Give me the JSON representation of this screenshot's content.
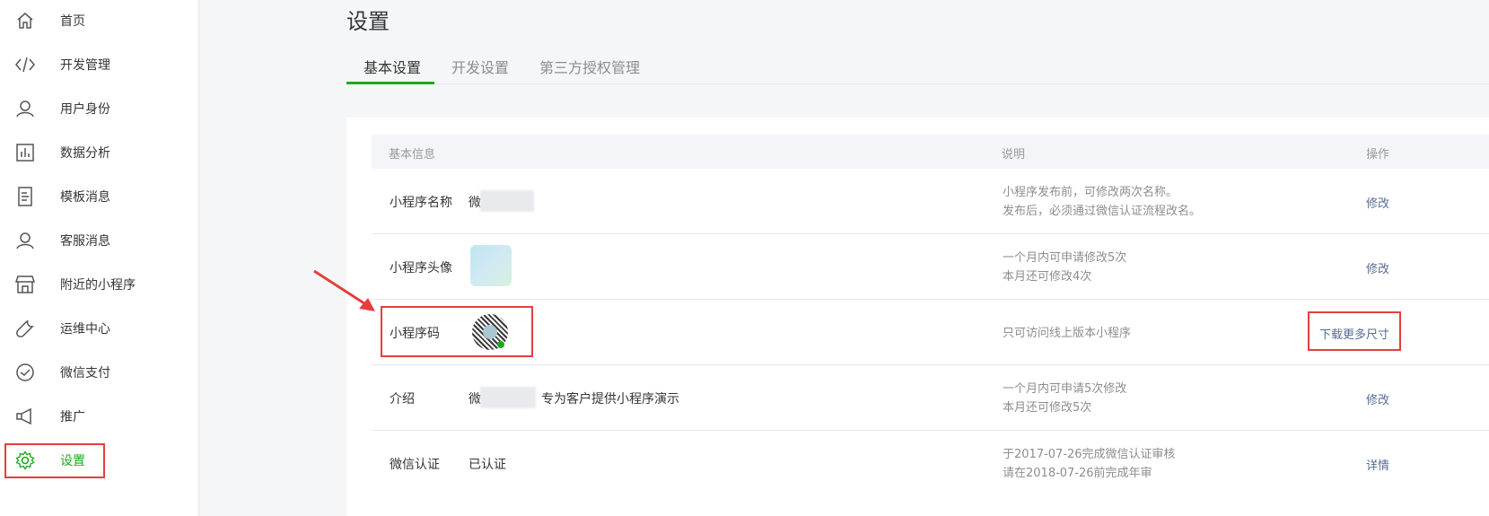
{
  "sidebar": {
    "items": [
      {
        "label": "首页",
        "icon": "home-icon"
      },
      {
        "label": "开发管理",
        "icon": "code-icon"
      },
      {
        "label": "用户身份",
        "icon": "user-icon"
      },
      {
        "label": "数据分析",
        "icon": "chart-icon"
      },
      {
        "label": "模板消息",
        "icon": "document-icon"
      },
      {
        "label": "客服消息",
        "icon": "support-icon"
      },
      {
        "label": "附近的小程序",
        "icon": "store-icon"
      },
      {
        "label": "运维中心",
        "icon": "wrench-icon"
      },
      {
        "label": "微信支付",
        "icon": "payment-icon"
      },
      {
        "label": "推广",
        "icon": "megaphone-icon"
      },
      {
        "label": "设置",
        "icon": "gear-icon",
        "active": true
      }
    ]
  },
  "page": {
    "title": "设置",
    "tabs": [
      "基本设置",
      "开发设置",
      "第三方授权管理"
    ]
  },
  "table": {
    "headers": {
      "info": "基本信息",
      "desc": "说明",
      "op": "操作"
    },
    "rows": [
      {
        "label": "小程序名称",
        "value": "微",
        "desc": [
          "小程序发布前，可修改两次名称。",
          "发布后，必须通过微信认证流程改名。"
        ],
        "action": "修改"
      },
      {
        "label": "小程序头像",
        "value": "",
        "desc": [
          "一个月内可申请修改5次",
          "本月还可修改4次"
        ],
        "action": "修改"
      },
      {
        "label": "小程序码",
        "value": "",
        "desc": [
          "只可访问线上版本小程序"
        ],
        "action": "下载更多尺寸"
      },
      {
        "label": "介绍",
        "value": "微",
        "value_suffix": "专为客户提供小程序演示",
        "desc": [
          "一个月内可申请5次修改",
          "本月还可修改5次"
        ],
        "action": "修改"
      },
      {
        "label": "微信认证",
        "value": "已认证",
        "desc": [
          "于2017-07-26完成微信认证审核",
          "请在2018-07-26前完成年审"
        ],
        "action": "详情"
      }
    ]
  },
  "colors": {
    "accent_green": "#1aad19",
    "link_blue": "#576b95",
    "highlight_red": "#e53e3e"
  }
}
